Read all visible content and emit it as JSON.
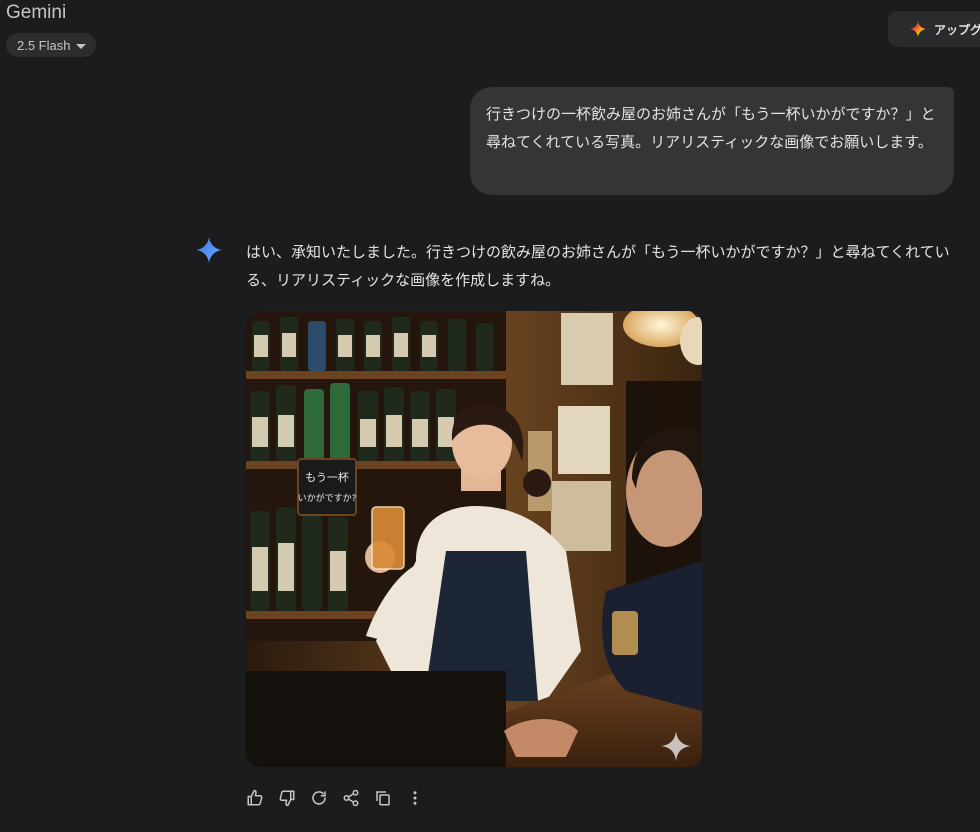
{
  "header": {
    "app_title": "Gemini",
    "model_label": "2.5 Flash",
    "upgrade_label": "アップグ"
  },
  "conversation": {
    "user_message": "行きつけの一杯飲み屋のお姉さんが「もう一杯いかがですか？」と尋ねてくれている写真。リアリスティックな画像でお願いします。",
    "reply_text": "はい、承知いたしました。行きつけの飲み屋のお姉さんが「もう一杯いかがですか？」と尋ねてくれている、リアリスティックな画像を作成しますね。",
    "image": {
      "chalkboard_line1": "もう一杯",
      "chalkboard_line2": "いかがですか?"
    }
  },
  "actions": [
    "thumbs-up",
    "thumbs-down",
    "regenerate",
    "share",
    "copy",
    "more"
  ],
  "colors": {
    "background": "#1b1c1d",
    "bubble": "#333537",
    "accent_blue": "#4c8df6"
  }
}
